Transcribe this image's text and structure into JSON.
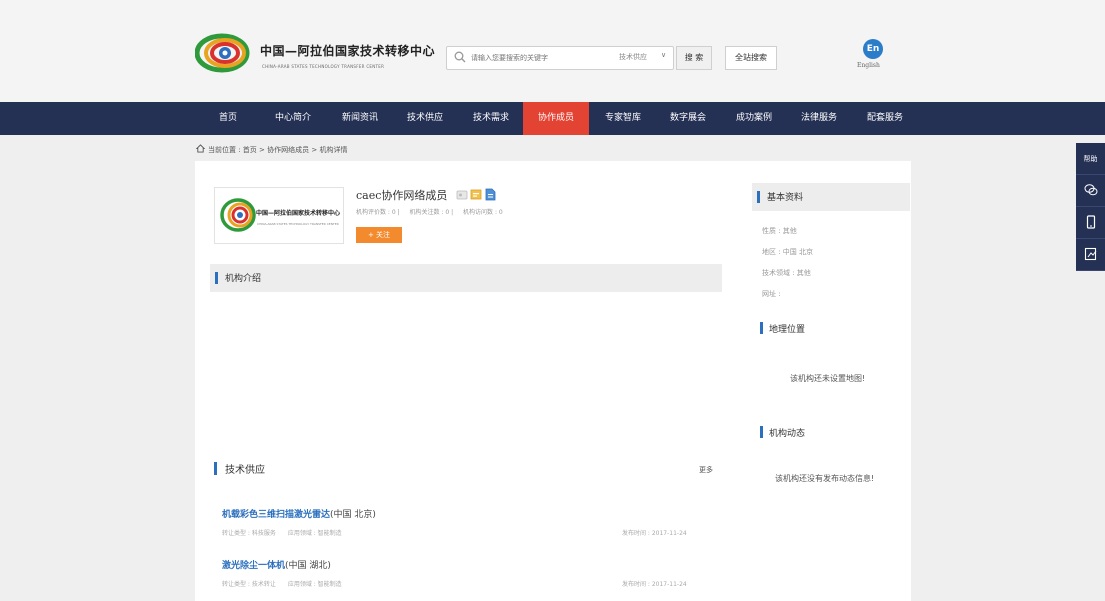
{
  "header": {
    "logo_cn": "中国—阿拉伯国家技术转移中心",
    "logo_en": "CHINA-ARAB STATES TECHNOLOGY TRANSFER CENTER",
    "search_placeholder": "请输入您要搜索的关键字",
    "search_category": "技术供应",
    "search_button": "搜 索",
    "global_search_button": "全站搜索",
    "lang_icon": "En",
    "lang_label": "English"
  },
  "nav": {
    "items": [
      "首页",
      "中心简介",
      "新闻资讯",
      "技术供应",
      "技术需求",
      "协作成员",
      "专家智库",
      "数字展会",
      "成功案例",
      "法律服务",
      "配套服务"
    ],
    "active_index": 5,
    "active_color": "#e34333",
    "bar_color": "#243154"
  },
  "breadcrumb": {
    "icon": "home-icon",
    "text": "当前位置 : 首页 > 协作网络成员 > 机构详情"
  },
  "org": {
    "logo_cn": "中国—阿拉伯国家技术转移中心",
    "logo_en": "CHINA-ARAB STATES TECHNOLOGY TRANSFER CENTER",
    "name": "caec协作网络成员",
    "icons": [
      "member-card-icon",
      "certificate-icon",
      "document-icon"
    ],
    "stats": [
      "机构评价数 : 0 |",
      "机构关注数 : 0 |",
      "机构访问数 : 0"
    ],
    "follow_button": "+ 关注"
  },
  "intro": {
    "title": "机构介绍"
  },
  "sidebar": {
    "basic_title": "基本资料",
    "basic_rows": [
      "性质 : 其他",
      "地区 : 中国 北京",
      "技术领域 : 其他",
      "网址 :"
    ],
    "location_title": "地理位置",
    "location_msg": "该机构还未设置地图!",
    "news_title": "机构动态",
    "news_msg": "该机构还没有发布动态信息!"
  },
  "supply": {
    "title": "技术供应",
    "more": "更多",
    "items": [
      {
        "title": "机载彩色三维扫描激光雷达",
        "location": "(中国 北京)",
        "type": "转让类型 : 科技服务",
        "field": "应用领域 : 智能制造",
        "date": "发布时间 : 2017-11-24"
      },
      {
        "title": "激光除尘一体机",
        "location": "(中国 湖北)",
        "type": "转让类型 : 技术转让",
        "field": "应用领域 : 智能制造",
        "date": "发布时间 : 2017-11-24"
      }
    ]
  },
  "float_bar": {
    "help_label": "帮助",
    "icons": [
      "wechat-icon",
      "mobile-icon",
      "share-icon"
    ]
  }
}
